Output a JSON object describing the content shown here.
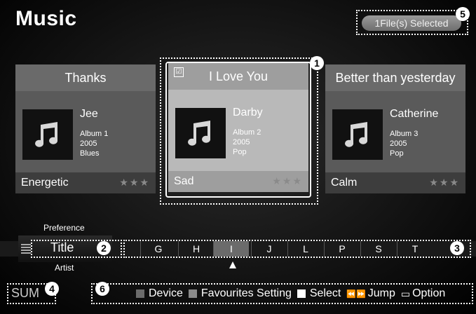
{
  "header": {
    "title": "Music",
    "selected": "1File(s) Selected"
  },
  "markers": [
    "1",
    "2",
    "3",
    "4",
    "5",
    "6"
  ],
  "cards": [
    {
      "title": "Thanks",
      "artist": "Jee",
      "album": "Album 1",
      "year": "2005",
      "genre": "Blues",
      "mood": "Energetic",
      "stars": "★★★"
    },
    {
      "title": "I Love You",
      "artist": "Darby",
      "album": "Album 2",
      "year": "2005",
      "genre": "Pop",
      "mood": "Sad",
      "stars": "★★★",
      "check": "☑"
    },
    {
      "title": "Better than yesterday",
      "artist": "Catherine",
      "album": "Album 3",
      "year": "2005",
      "genre": "Pop",
      "mood": "Calm",
      "stars": "★★★"
    }
  ],
  "sort": {
    "above": "Preference",
    "current": "Title",
    "below": "Artist"
  },
  "letters": [
    "G",
    "H",
    "I",
    "J",
    "L",
    "P",
    "S",
    "T"
  ],
  "active_letter": "I",
  "footer": {
    "sum": "SUM",
    "device": "Device",
    "favourites": "Favourites Setting",
    "select": "Select",
    "jump": "Jump",
    "option": "Option"
  },
  "colors": {
    "device": "#6b6b6b",
    "favourites": "#8a8a8a",
    "select": "#ffffff"
  }
}
